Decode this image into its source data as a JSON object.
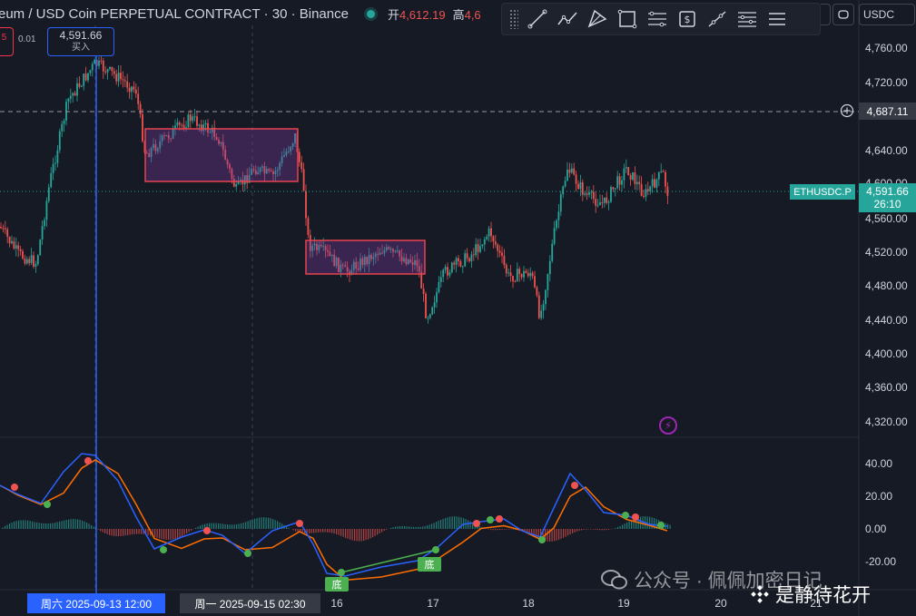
{
  "header": {
    "symbol_title": "eum / USD Coin PERPETUAL CONTRACT · 30 · Binance",
    "open_label": "开",
    "open_value": "4,612.19",
    "high_label": "高",
    "high_value": "4,6"
  },
  "toolbar": {
    "tools": [
      "trend-line-icon",
      "path-icon",
      "pitchfork-icon",
      "rectangle-icon",
      "parallel-channel-icon",
      "price-range-icon",
      "ray-icon",
      "fib-icon",
      "menu-icon"
    ]
  },
  "controls": {
    "currency": "USDC"
  },
  "order_panel": {
    "sell_partial": "5",
    "step": "0.01",
    "buy_price": "4,591.66",
    "buy_label": "买入"
  },
  "price_axis": {
    "ticks": [
      "4,760.00",
      "4,720.00",
      "4,680.00",
      "4,640.00",
      "4,600.00",
      "4,560.00",
      "4,520.00",
      "4,480.00",
      "4,440.00",
      "4,400.00",
      "4,360.00",
      "4,320.00"
    ],
    "crosshair_price": "4,687.11",
    "symbol_tag": "ETHUSDC.P",
    "last_price": "4,591.66",
    "countdown": "26:10"
  },
  "macd_axis": {
    "ticks": [
      "40.00",
      "20.00",
      "0.00",
      "-20.00"
    ]
  },
  "time_axis": {
    "labels": [
      "16",
      "17",
      "18",
      "19",
      "20",
      "21"
    ],
    "crosshair_date": "周六 2025-09-13   12:00",
    "hover_date": "周一 2025-09-15   02:30"
  },
  "signals": {
    "bottom_label": "底"
  },
  "watermark": {
    "account": "公众号 · 佩佩加密日记",
    "author": "是静待花开"
  },
  "colors": {
    "up": "#26a69a",
    "down": "#ef5350",
    "macd": "#2962ff",
    "signal": "#ff6d00",
    "box": "#e8434d",
    "accent": "#2962ff"
  }
}
